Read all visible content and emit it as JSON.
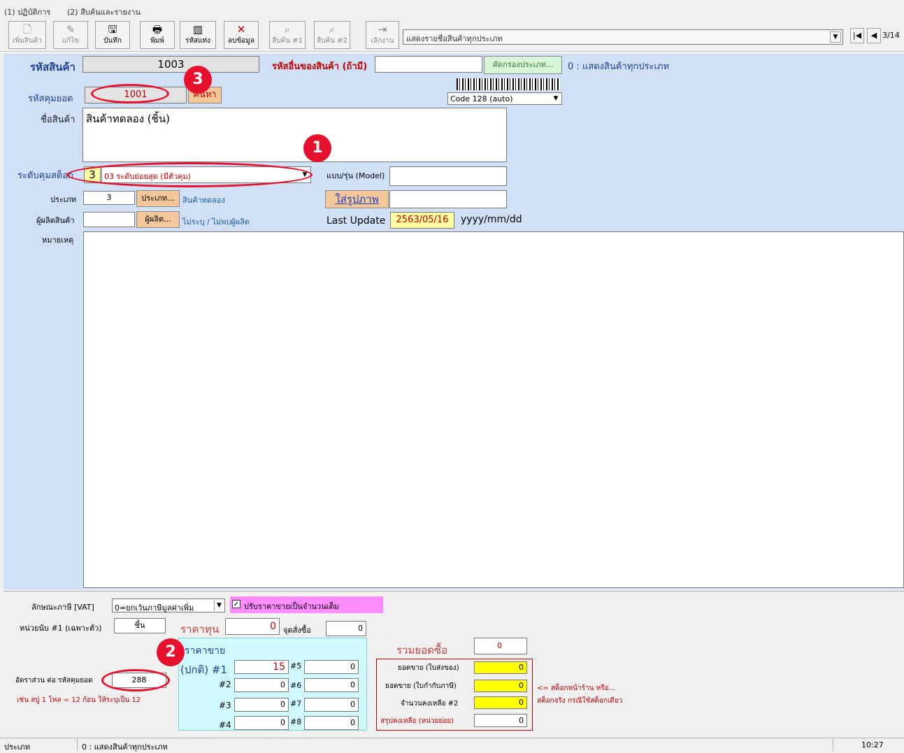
{
  "menu": [
    "(1) ปฏิบัติการ",
    "(2) สืบค้นและรายงาน"
  ],
  "toolbar": [
    {
      "label": "เพิ่มสินค้า",
      "icon": "🗋",
      "enabled": false
    },
    {
      "label": "แก้ไข",
      "icon": "✎",
      "enabled": false
    },
    {
      "label": "บันทึก",
      "icon": "🖫",
      "enabled": true
    },
    {
      "label": "พิมพ์",
      "icon": "🖶",
      "enabled": true
    },
    {
      "label": "รหัสแท่ง",
      "icon": "▥",
      "enabled": true
    },
    {
      "label": "ลบข้อมูล",
      "icon": "✕",
      "enabled": true
    },
    {
      "label": "สืบค้น #1",
      "icon": "⌕",
      "enabled": false
    },
    {
      "label": "สืบค้น #2",
      "icon": "⌕",
      "enabled": false
    },
    {
      "label": "เลิกงาน",
      "icon": "⇥",
      "enabled": false
    }
  ],
  "filter_combo": "แสดงรายชื่อสินค้าทุกประเภท",
  "record_nav": "3/14",
  "form": {
    "product_code_label": "รหัสสินค้า",
    "product_code": "1003",
    "other_code_label": "รหัสอื่นของสินค้า (ถ้ามี)",
    "other_code": "",
    "filter_type_button": "คัดกรองประเภท...",
    "filter_type_text": "0 : แสดงสินค้าทุกประเภท",
    "barcode_type": "Code 128 (auto)",
    "parent_code_label": "รหัสคุมยอด",
    "parent_code": "1001",
    "parent_button": "ค้นหา",
    "name_label": "ชื่อสินค้า",
    "name": "สินค้าทดลอง (ชิ้น)",
    "stock_level_label": "ระดับคุมสต็อก",
    "stock_level_num": "3",
    "stock_level_text": "03 ระดับย่อยสุด (มีตัวคุม)",
    "model_label": "แบบ/รุ่น (Model)",
    "model": "",
    "type_label": "ประเภท",
    "type_value": "3",
    "type_button": "ประเภท...",
    "type_name": "สินค้าทดลอง",
    "image_button": "ใส่รูปภาพ",
    "manufacturer_label": "ผู้ผลิตสินค้า",
    "manufacturer_value": "",
    "manufacturer_button": "ผู้ผลิต...",
    "manufacturer_name": "ไม่ระบุ / ไม่พบผู้ผลิต",
    "last_update_label": "Last Update",
    "last_update": "2563/05/16",
    "date_format": "yyyy/mm/dd",
    "remark_label": "หมายเหตุ"
  },
  "bottom": {
    "vat_label": "ลักษณะภาษี [VAT]",
    "vat_value": "0=ยกเว้นภาษีมูลค่าเพิ่ม",
    "round_label": "ปรับราคาขายเป็นจำนวนเต็ม",
    "unit_label": "หน่วยนับ #1 (เฉพาะตัว)",
    "unit_value": "ชิ้น",
    "cost_label": "ราคาทุน",
    "cost_value": "0",
    "reorder_label": "จุดสั่งซื้อ",
    "reorder_value": "0",
    "ratio_label": "อัตราส่วน ต่อ รหัสคุมยอด",
    "ratio_value": "288",
    "ratio_hint": "เช่น สบู่ 1 โหล = 12 ก้อน ให้ระบุเป็น 12",
    "price_group_label": "ราคาขาย",
    "price_normal_label": "(ปกติ) #1",
    "prices": {
      "p1": "15",
      "p2": "0",
      "p3": "0",
      "p4": "0",
      "p5": "0",
      "p6": "0",
      "p7": "0",
      "p8": "0"
    },
    "price_labels": {
      "l2": "#2",
      "l3": "#3",
      "l4": "#4",
      "l5": "#5",
      "l6": "#6",
      "l7": "#7",
      "l8": "#8"
    },
    "total_purchase_label": "รวมยอดซื้อ",
    "total_purchase": "0",
    "sales_delivery_label": "ยอดขาย (ใบส่งของ)",
    "sales_delivery": "0",
    "sales_tax_label": "ยอดขาย (ใบกำกับภาษี)",
    "sales_tax": "0",
    "remain2_label": "จำนวนคงเหลือ #2",
    "remain2": "0",
    "summary_label": "สรุปคงเหลือ (หน่วยย่อย)",
    "summary": "0",
    "note1": "<= สต็อกหน้าร้าน หรือ...",
    "note2": "สต็อกจริง กรณีใช้สต็อกเดียว"
  },
  "status": {
    "left": "ประเภท",
    "middle": "0 : แสดงสินค้าทุกประเภท",
    "time": "10:27"
  },
  "callouts": [
    "1",
    "2",
    "3"
  ]
}
